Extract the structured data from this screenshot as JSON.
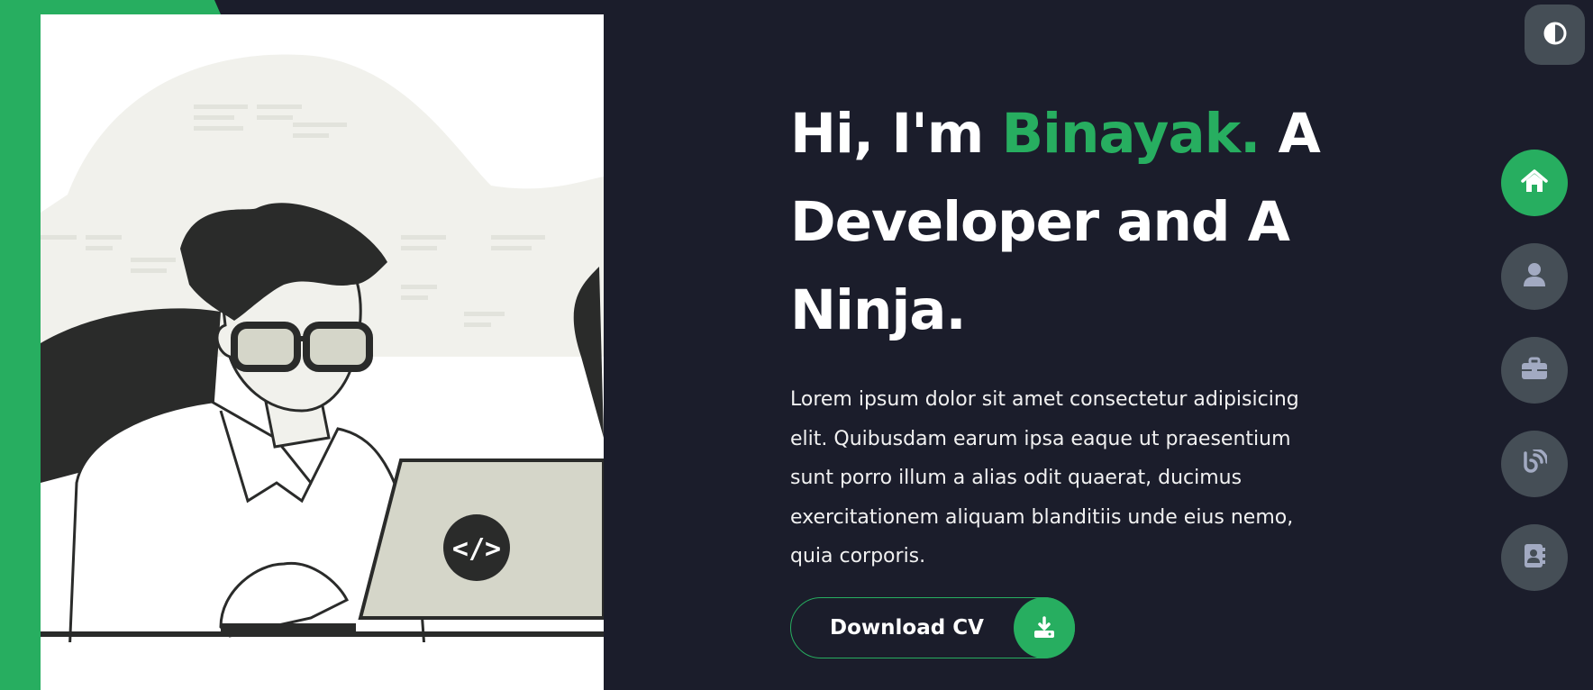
{
  "colors": {
    "background": "#1b1d2b",
    "accent": "#27ae60",
    "nav_button": "#454e56",
    "text": "#ffffff"
  },
  "hero": {
    "headline_prefix": "Hi, I'm",
    "headline_name": "Binayak.",
    "headline_suffix": "A Developer and A Ninja.",
    "description": "Lorem ipsum dolor sit amet consectetur adipisicing elit. Quibusdam earum ipsa eaque ut praesentium sunt porro illum a alias odit quaerat, ducimus exercitationem aliquam blanditiis unde eius nemo, quia corporis.",
    "cta_label": "Download CV",
    "cta_icon": "download-icon",
    "image_icon_text": "</>"
  },
  "theme_toggle": {
    "icon": "contrast-icon"
  },
  "side_nav": {
    "items": [
      {
        "icon": "home-icon",
        "active": true
      },
      {
        "icon": "user-icon",
        "active": false
      },
      {
        "icon": "briefcase-icon",
        "active": false
      },
      {
        "icon": "blog-icon",
        "active": false
      },
      {
        "icon": "contact-book-icon",
        "active": false
      }
    ]
  }
}
